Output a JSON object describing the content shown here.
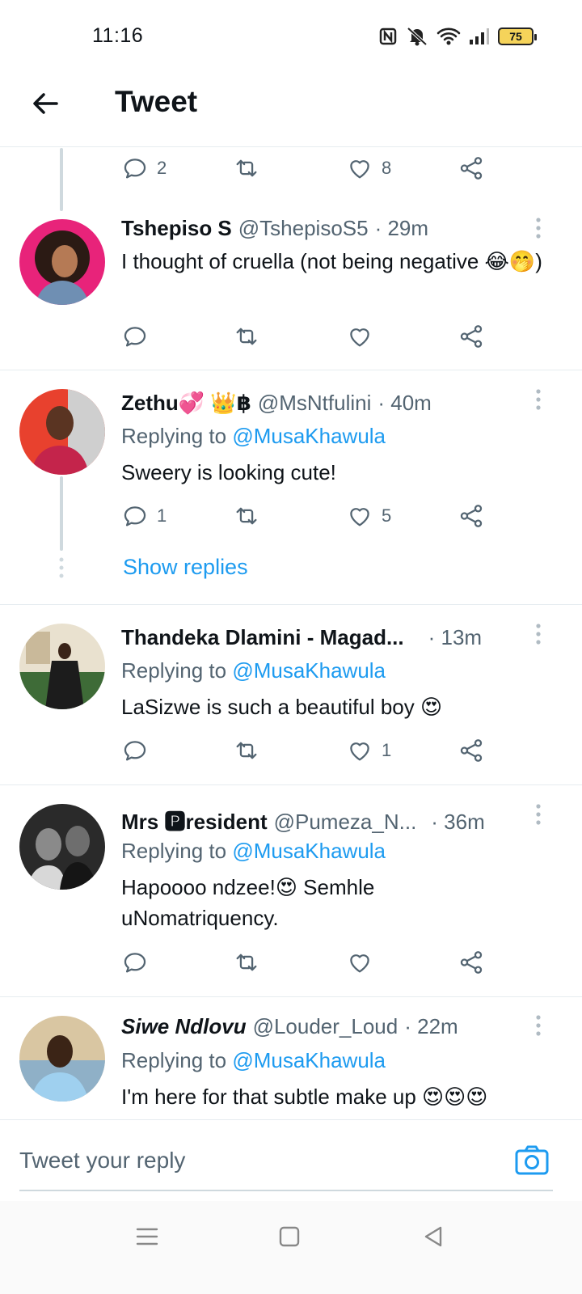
{
  "status_bar": {
    "time": "11:16",
    "battery": "75"
  },
  "header": {
    "title": "Tweet"
  },
  "prev_tweet_actions": {
    "replies": "2",
    "likes": "8"
  },
  "tweets": [
    {
      "name": "Tshepiso S",
      "handle": "@TshepisoS5",
      "time": "· 29m",
      "text": "I thought of cruella (not being negative 😂🤭)",
      "replies": "",
      "likes": ""
    },
    {
      "name": "Zethu💞 👑฿",
      "handle": "@MsNtfulini",
      "time": "· 40m",
      "replying_prefix": "Replying to",
      "replying_to": "@MusaKhawula",
      "text": "Sweery is looking cute!",
      "replies": "1",
      "likes": "5",
      "show_replies": "Show replies"
    },
    {
      "name": "Thandeka Dlamini - Magad...",
      "handle": "",
      "time": "· 13m",
      "replying_prefix": "Replying to",
      "replying_to": "@MusaKhawula",
      "text": "LaSizwe is such a beautiful boy 😍",
      "replies": "",
      "likes": "1"
    },
    {
      "name": "Mrs 🅿resident",
      "handle": "@Pumeza_N...",
      "time": "· 36m",
      "replying_prefix": "Replying to",
      "replying_to": "@MusaKhawula",
      "text": "Hapoooo ndzee!😍 Semhle uNomatriquency.",
      "replies": "",
      "likes": ""
    },
    {
      "name": "Siwe Ndlovu",
      "handle": "@Louder_Loud",
      "time": "· 22m",
      "replying_prefix": "Replying to",
      "replying_to": "@MusaKhawula",
      "text": "I'm here for that subtle make up 😍😍😍"
    }
  ],
  "reply_bar": {
    "placeholder": "Tweet your reply"
  },
  "icons": {
    "reply": "reply-icon",
    "retweet": "retweet-icon",
    "like": "heart-icon",
    "share": "share-icon",
    "more": "more-icon",
    "camera": "camera-icon",
    "back": "back-arrow-icon"
  },
  "colors": {
    "accent": "#1d9bf0",
    "text": "#0f1419",
    "muted": "#536471"
  }
}
